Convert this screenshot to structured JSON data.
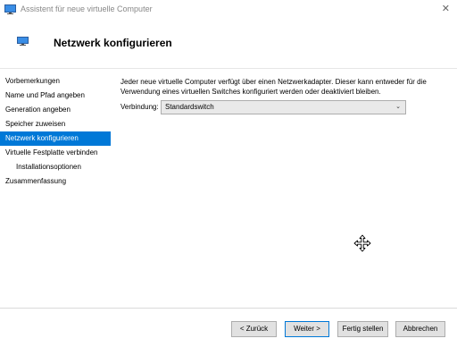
{
  "window": {
    "title": "Assistent für neue virtuelle Computer",
    "close_glyph": "✕",
    "icon": "monitor-icon"
  },
  "header": {
    "title": "Netzwerk konfigurieren",
    "icon": "monitor-icon"
  },
  "nav": {
    "items": [
      {
        "label": "Vorbemerkungen",
        "indent": false,
        "selected": false
      },
      {
        "label": "Name und Pfad angeben",
        "indent": false,
        "selected": false
      },
      {
        "label": "Generation angeben",
        "indent": false,
        "selected": false
      },
      {
        "label": "Speicher zuweisen",
        "indent": false,
        "selected": false
      },
      {
        "label": "Netzwerk konfigurieren",
        "indent": false,
        "selected": true
      },
      {
        "label": "Virtuelle Festplatte verbinden",
        "indent": false,
        "selected": false
      },
      {
        "label": "Installationsoptionen",
        "indent": true,
        "selected": false
      },
      {
        "label": "Zusammenfassung",
        "indent": false,
        "selected": false
      }
    ]
  },
  "content": {
    "description": "Jeder neue virtuelle Computer verfügt über einen Netzwerkadapter. Dieser kann entweder für die Verwendung eines virtuellen Switches konfiguriert werden oder deaktiviert bleiben.",
    "connection_label": "Verbindung:",
    "connection_value": "Standardswitch",
    "chevron": "⌄"
  },
  "footer": {
    "back": "< Zurück",
    "next": "Weiter >",
    "finish": "Fertig stellen",
    "cancel": "Abbrechen"
  },
  "colors": {
    "accent": "#0078d7"
  }
}
